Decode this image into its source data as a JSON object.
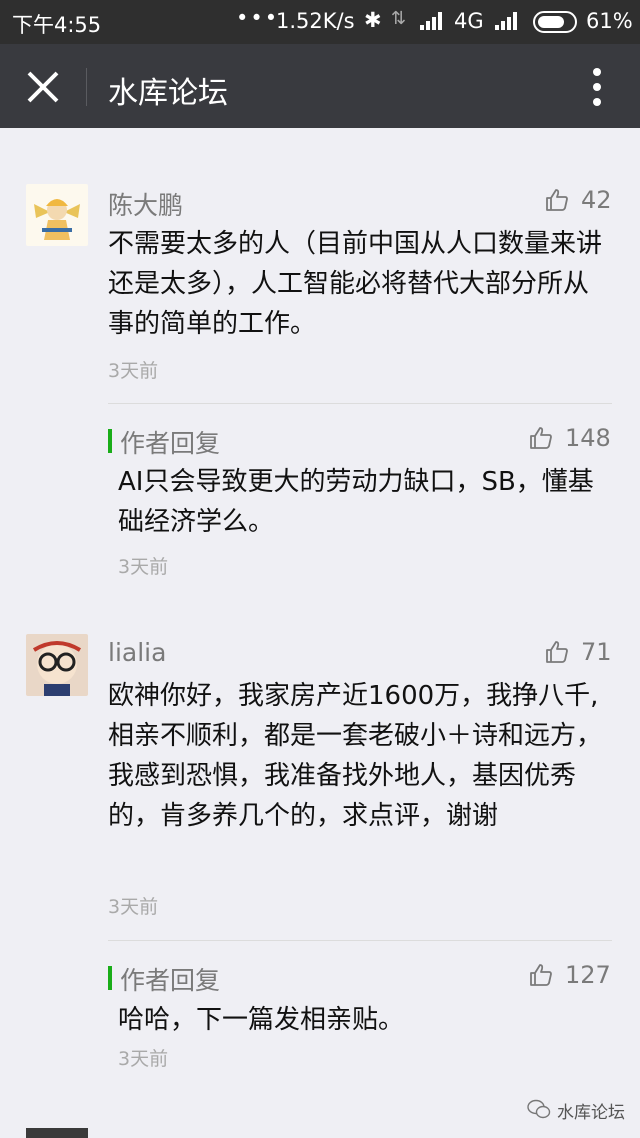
{
  "status_bar": {
    "time": "下午4:55",
    "dots": "•••",
    "speed": "1.52K/s",
    "network": "4G",
    "battery": "61%"
  },
  "header": {
    "title": "水库论坛"
  },
  "comments": [
    {
      "name": "陈大鹏",
      "likes": "42",
      "text": "不需要太多的人（目前中国从人口数量来讲还是太多），人工智能必将替代大部分所从事的简单的工作。",
      "time": "3天前",
      "reply": {
        "label": "作者回复",
        "likes": "148",
        "text": "AI只会导致更大的劳动力缺口，SB，懂基础经济学么。",
        "time": "3天前"
      }
    },
    {
      "name": "lialia",
      "likes": "71",
      "text": "欧神你好，我家房产近1600万，我挣八千,相亲不顺利，都是一套老破小＋诗和远方，我感到恐惧，我准备找外地人，基因优秀的，肯多养几个的，求点评，谢谢",
      "time": "3天前",
      "reply": {
        "label": "作者回复",
        "likes": "127",
        "text": "哈哈，下一篇发相亲贴。",
        "time": "3天前"
      }
    }
  ],
  "watermark": "水库论坛",
  "colors": {
    "accent": "#1aad19",
    "header_bg": "#393a3f",
    "status_bg": "#2f2f2f",
    "page_bg": "#efeff4"
  }
}
